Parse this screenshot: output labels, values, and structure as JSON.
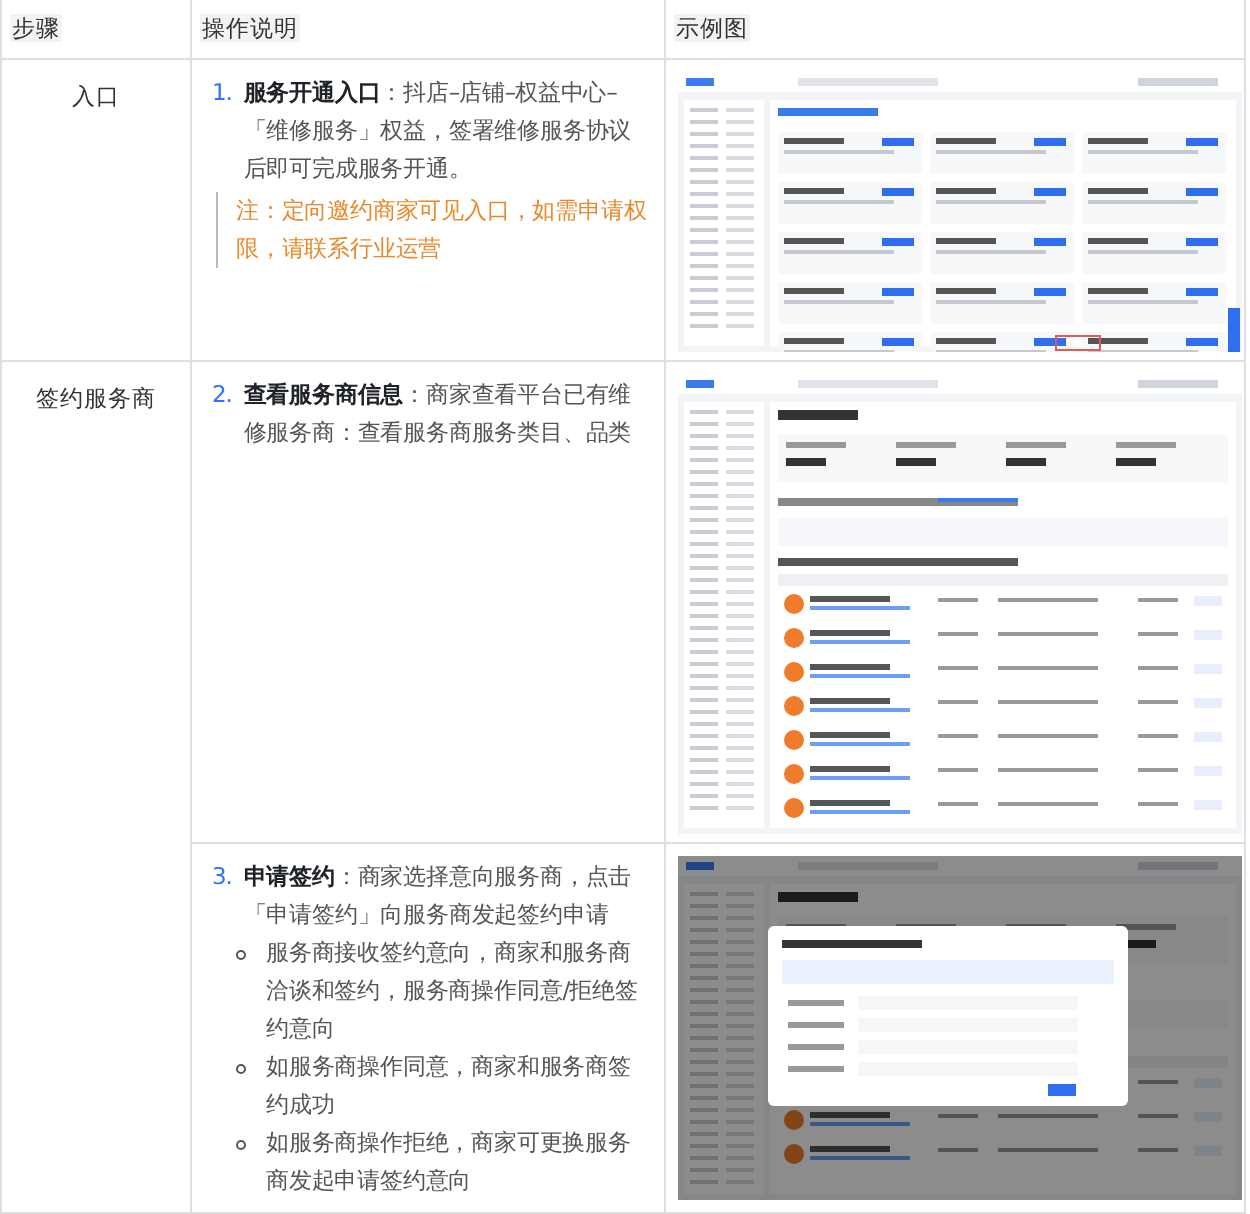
{
  "columns": [
    "步骤",
    "操作说明",
    "示例图"
  ],
  "sections": [
    {
      "step": "入口",
      "entries": [
        {
          "number": "1.",
          "text": "**服务开通入口**：抖店–店铺–权益中心–「维修服务」权益，签署维修服务协议后即可完成服务开通。",
          "note": "注：定向邀约商家可见入口，如需申请权限，请联系行业运营",
          "image": {
            "kind": "cards"
          }
        }
      ]
    },
    {
      "step": "签约服务商",
      "entries": [
        {
          "number": "2.",
          "text": "**查看服务商信息**：商家查看平台已有维修服务商：查看服务商服务类目、品类",
          "image": {
            "kind": "table"
          }
        },
        {
          "number": "3.",
          "text": "**申请签约**：商家选择意向服务商，点击「申请签约」向服务商发起签约申请",
          "bullets": [
            "服务商接收签约意向，商家和服务商洽谈和签约，服务商操作同意/拒绝签约意向",
            "如服务商操作同意，商家和服务商签约成功",
            "如服务商操作拒绝，商家可更换服务商发起申请签约意向"
          ],
          "image": {
            "kind": "dialog"
          }
        }
      ]
    }
  ]
}
